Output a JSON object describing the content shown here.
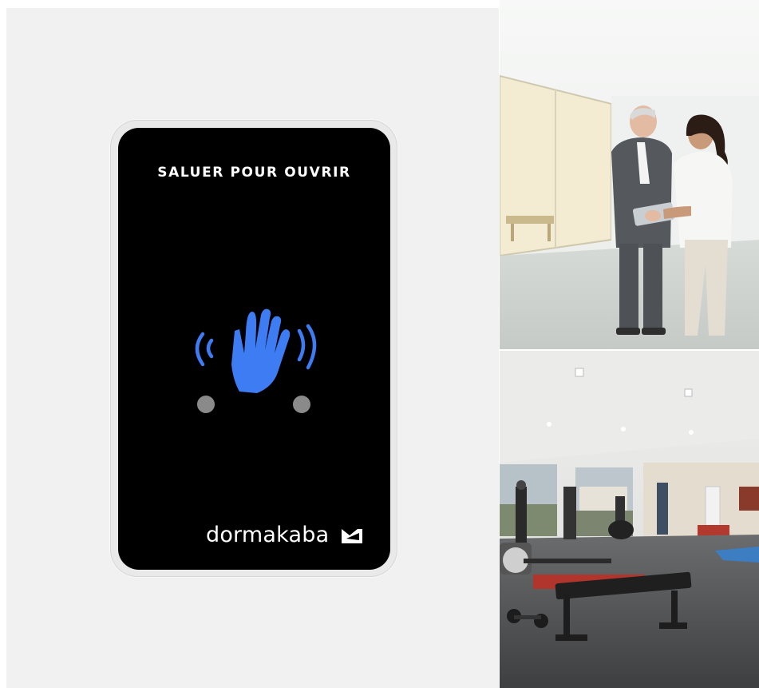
{
  "device": {
    "title": "SALUER POUR OUVRIR",
    "brand": "dormakaba",
    "icon": "waving-hand-icon",
    "icon_color": "#3d7cf2"
  },
  "photos": [
    {
      "name": "office-photo"
    },
    {
      "name": "gym-photo"
    }
  ]
}
